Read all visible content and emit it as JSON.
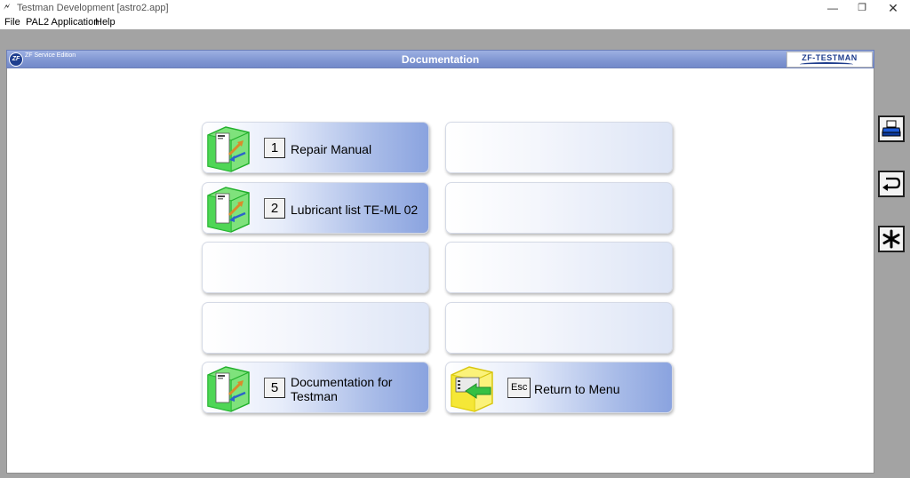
{
  "window": {
    "title": "Testman Development [astro2.app]",
    "minimize_glyph": "—",
    "maximize_glyph": "❐",
    "close_glyph": "✕"
  },
  "menu": {
    "items": [
      "File",
      "PAL2 Application",
      "Help"
    ]
  },
  "header": {
    "edition": "ZF Service Edition",
    "title": "Documentation",
    "logo_text": "ZF",
    "brand": "ZF-TESTMAN"
  },
  "tools": [
    {
      "name": "print-icon"
    },
    {
      "name": "back-icon"
    },
    {
      "name": "asterisk-icon"
    }
  ],
  "tiles": [
    {
      "key": "1",
      "label": "Repair Manual",
      "icon": "documentation-cube-icon"
    },
    {
      "key": "2",
      "label": "Lubricant list TE-ML 02",
      "icon": "documentation-cube-icon"
    },
    {
      "key": "5",
      "label": "Documentation for Testman",
      "label_lines": [
        "Documentation for",
        "Testman"
      ],
      "icon": "documentation-cube-icon"
    },
    {
      "key": "Esc",
      "label": "Return to Menu",
      "icon": "return-arrow-cube-icon"
    }
  ],
  "colors": {
    "header_blue": "#8197d3",
    "cube_green": "#2ec43a",
    "cube_yellow": "#f2e21b",
    "brand_blue": "#1e3c8c"
  }
}
